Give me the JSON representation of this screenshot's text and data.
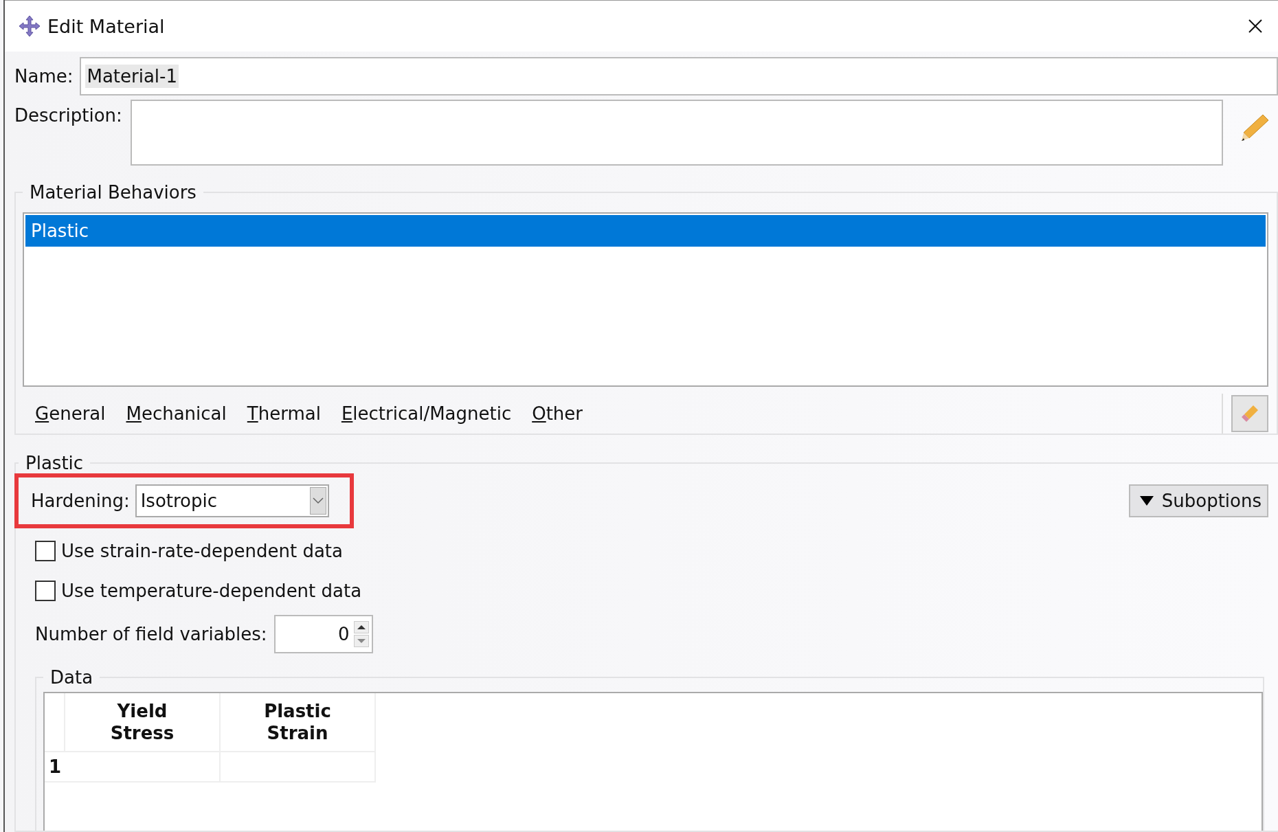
{
  "window": {
    "title": "Edit Material"
  },
  "name": {
    "label": "Name:",
    "value": "Material-1"
  },
  "description": {
    "label": "Description:"
  },
  "behaviors": {
    "title": "Material Behaviors",
    "items": [
      {
        "label": "Plastic",
        "selected": true
      }
    ],
    "menus": [
      {
        "label": "General"
      },
      {
        "label": "Mechanical"
      },
      {
        "label": "Thermal"
      },
      {
        "label": "Electrical/Magnetic"
      },
      {
        "label": "Other"
      }
    ]
  },
  "plastic": {
    "title": "Plastic",
    "hardening": {
      "label": "Hardening:",
      "value": "Isotropic",
      "highlighted": true
    },
    "suboptions": "Suboptions",
    "options": [
      {
        "label": "Use strain-rate-dependent data",
        "checked": false
      },
      {
        "label": "Use temperature-dependent data",
        "checked": false
      }
    ],
    "field_variables": {
      "label": "Number of field variables:",
      "value": "0"
    },
    "data": {
      "title": "Data",
      "columns": [
        "Yield Stress",
        "Plastic Strain"
      ],
      "rows": [
        {
          "number": "1"
        }
      ]
    }
  }
}
